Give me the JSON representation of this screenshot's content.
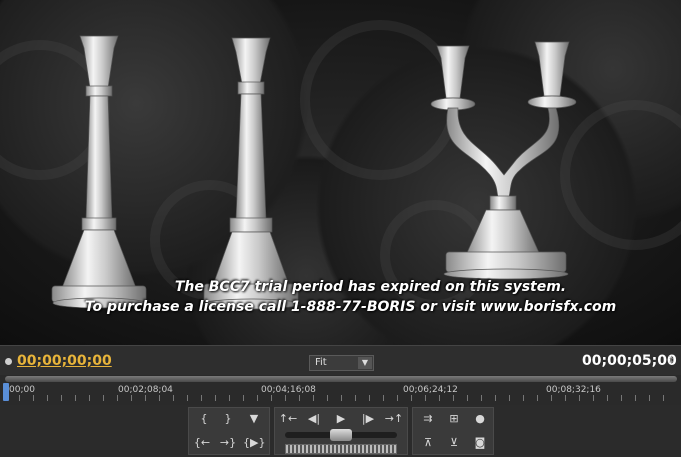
{
  "preview": {
    "watermark_line1": "The BCC7 trial period has expired on this system.",
    "watermark_line2": "To purchase a license call 1-888-77-BORIS or visit www.borisfx.com"
  },
  "timebar": {
    "current_timecode": "00;00;00;00",
    "zoom_select": "Fit",
    "duration_timecode": "00;00;05;00"
  },
  "ruler": {
    "ticks": [
      "00;00",
      "00;02;08;04",
      "00;04;16;08",
      "00;06;24;12",
      "00;08;32;16"
    ]
  },
  "controls": {
    "left_group": {
      "row1": [
        "mark-in-icon",
        "mark-out-icon",
        "set-marker-icon"
      ],
      "row2": [
        "go-to-in-icon",
        "go-to-out-icon",
        "play-in-to-out-icon"
      ]
    },
    "transport": [
      "step-back-icon",
      "step-back-frame-icon",
      "play-icon",
      "step-forward-frame-icon",
      "step-forward-icon"
    ],
    "right_group": {
      "row1": [
        "loop-icon",
        "safe-margins-icon",
        "output-icon"
      ],
      "row2": [
        "lift-icon",
        "extract-icon",
        "export-frame-icon"
      ]
    }
  },
  "colors": {
    "timecode_current": "#e8b43a",
    "playhead": "#5a8fd8",
    "panel": "#2b2b2b"
  }
}
